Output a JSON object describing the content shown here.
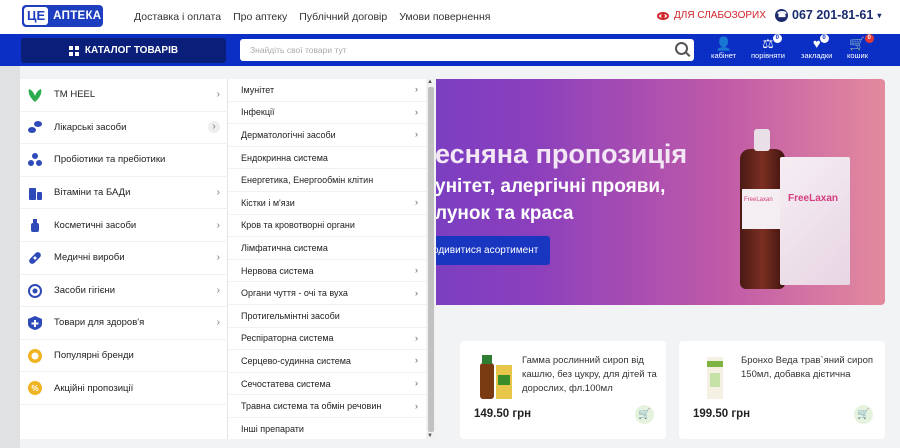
{
  "header": {
    "logo_ce": "ЦЕ",
    "logo_text": "АПТЕКА",
    "nav": [
      "Доставка і оплата",
      "Про аптеку",
      "Публічний договір",
      "Умови повернення"
    ],
    "visually_impaired": "ДЛЯ СЛАБОЗОРИХ",
    "phone": "067 201-81-61"
  },
  "toolbar": {
    "catalog_label": "КАТАЛОГ ТОВАРІВ",
    "search_placeholder": "Знайдіть свої товари тут",
    "cabinet": "кабінет",
    "compare": "порівняти",
    "compare_count": "0",
    "bookmarks": "закладки",
    "bookmarks_count": "0",
    "cart": "кошик",
    "cart_count": "0"
  },
  "menu": {
    "items": [
      {
        "label": "ТМ HEEL",
        "icon": "heel-leaf-icon",
        "arrow": true
      },
      {
        "label": "Лікарські засоби",
        "icon": "pills-icon",
        "arrow": true
      },
      {
        "label": "Пробіотики та пребіотики",
        "icon": "probiotic-icon",
        "arrow": false
      },
      {
        "label": "Вітаміни та БАДи",
        "icon": "vitamins-icon",
        "arrow": true
      },
      {
        "label": "Косметичні засоби",
        "icon": "cosmetics-icon",
        "arrow": true
      },
      {
        "label": "Медичні вироби",
        "icon": "bandage-icon",
        "arrow": true
      },
      {
        "label": "Засоби гігієни",
        "icon": "hygiene-icon",
        "arrow": true
      },
      {
        "label": "Товари для здоров'я",
        "icon": "health-cross-icon",
        "arrow": true
      },
      {
        "label": "Популярні бренди",
        "icon": "brand-badge-icon",
        "arrow": false
      },
      {
        "label": "Акційні пропозиції",
        "icon": "discount-icon",
        "arrow": false
      }
    ]
  },
  "submenu": {
    "items": [
      {
        "label": "Імунітет",
        "arrow": true
      },
      {
        "label": "Інфекції",
        "arrow": true
      },
      {
        "label": "Дерматологічні засоби",
        "arrow": true
      },
      {
        "label": "Ендокринна система",
        "arrow": false
      },
      {
        "label": "Енергетика, Енергообмін клітин",
        "arrow": false
      },
      {
        "label": "Кістки і м'язи",
        "arrow": true
      },
      {
        "label": "Кров та кровотворні органи",
        "arrow": false
      },
      {
        "label": "Лімфатична система",
        "arrow": false
      },
      {
        "label": "Нервова система",
        "arrow": true
      },
      {
        "label": "Органи чуття - очі та вуха",
        "arrow": true
      },
      {
        "label": "Протигельмінтні засоби",
        "arrow": false
      },
      {
        "label": "Респіраторна система",
        "arrow": true
      },
      {
        "label": "Серцево-судинна система",
        "arrow": true
      },
      {
        "label": "Сечостатева система",
        "arrow": true
      },
      {
        "label": "Травна система та обмін речовин",
        "arrow": true
      },
      {
        "label": "Інші препарати",
        "arrow": false
      }
    ]
  },
  "banner": {
    "line1": "есняна пропозиція",
    "line2": "унітет, алергічні прояви,",
    "line3": "лунок та краса",
    "button": "одивитися асортимент",
    "bottle_label": "FreeLaxan",
    "box_label": "FreeLaxan"
  },
  "products": [
    {
      "name": "Гамма рослинний сироп від кашлю, без цукру, для дітей та дорослих, фл.100мл",
      "price": "149.50 грн"
    },
    {
      "name": "Бронхо Веда трав`яний сироп 150мл, добавка дієтична",
      "price": "199.50 грн"
    }
  ],
  "colors": {
    "brand_blue": "#0b2fc4",
    "dark_blue": "#0a1f7a",
    "accent_red": "#d0242b",
    "green": "#5bac2e"
  }
}
